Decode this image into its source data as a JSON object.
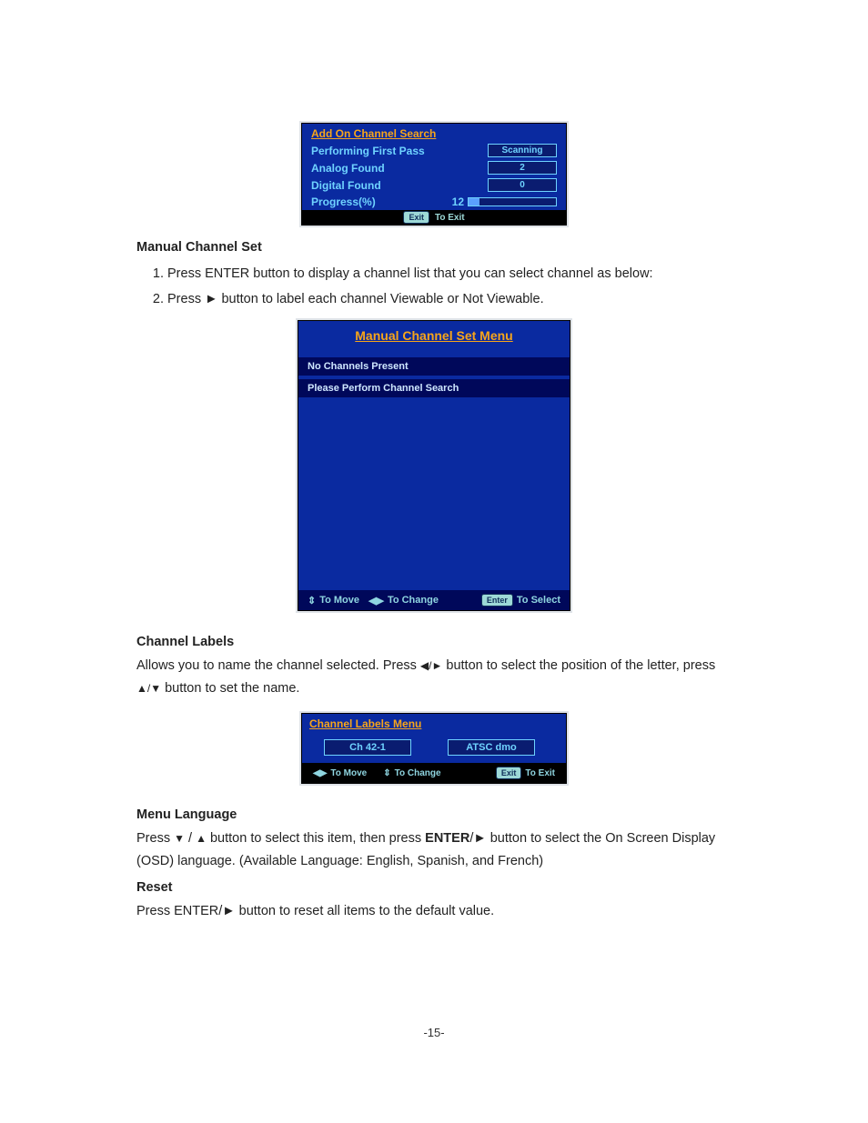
{
  "scan_panel": {
    "title": "Add On Channel Search",
    "rows": {
      "first_pass": {
        "label": "Performing First Pass",
        "status": "Scanning"
      },
      "analog": {
        "label": "Analog    Found",
        "value": "2"
      },
      "digital": {
        "label": "Digital Found",
        "value": "0"
      },
      "progress": {
        "label": "Progress(%)",
        "value": "12",
        "pct": 12
      }
    },
    "footer": {
      "btn": "Exit",
      "text": "To Exit"
    }
  },
  "manual_channel_set": {
    "heading": "Manual Channel Set",
    "steps": [
      "Press ENTER button to display a channel list that you can select channel as below:",
      "Press ► button to label each channel Viewable or Not Viewable."
    ]
  },
  "mcs_panel": {
    "title": "Manual Channel Set  Menu",
    "msg1": "No Channels Present",
    "msg2": "Please Perform Channel Search",
    "hints": {
      "move": {
        "glyph": "⇕",
        "text": "To Move"
      },
      "change": {
        "glyph": "◀▶",
        "text": "To Change"
      },
      "select": {
        "btn": "Enter",
        "text": "To Select"
      }
    }
  },
  "channel_labels": {
    "heading": "Channel Labels",
    "para_pre": "Allows you to name the channel selected. Press ",
    "para_mid_glyph": "◀/►",
    "para_after": " button to select the position of the letter, press",
    "line2_glyph": "▲/▼",
    "line2_after": "   button to set the name."
  },
  "clm_panel": {
    "title": "Channel Labels  Menu",
    "field1": "Ch 42-1",
    "field2": "ATSC dmo",
    "hints": {
      "move": {
        "glyph": "◀▶",
        "text": "To Move"
      },
      "change": {
        "glyph": "⇕",
        "text": "To Change"
      },
      "exit": {
        "btn": "Exit",
        "text": "To Exit"
      }
    }
  },
  "menu_language": {
    "heading": "Menu Language",
    "pre": "Press ",
    "glyph1": "▼",
    "mid1": "  /  ",
    "glyph2": "▲",
    "text1": " button to select this item, then press ",
    "enter": "ENTER",
    "text2": "/► button to select the On Screen Display (OSD) language. (Available Language: English, Spanish, and French)"
  },
  "reset": {
    "heading": "Reset",
    "text": "Press ENTER/► button to reset all items to the default value."
  },
  "page_number": "-15-"
}
